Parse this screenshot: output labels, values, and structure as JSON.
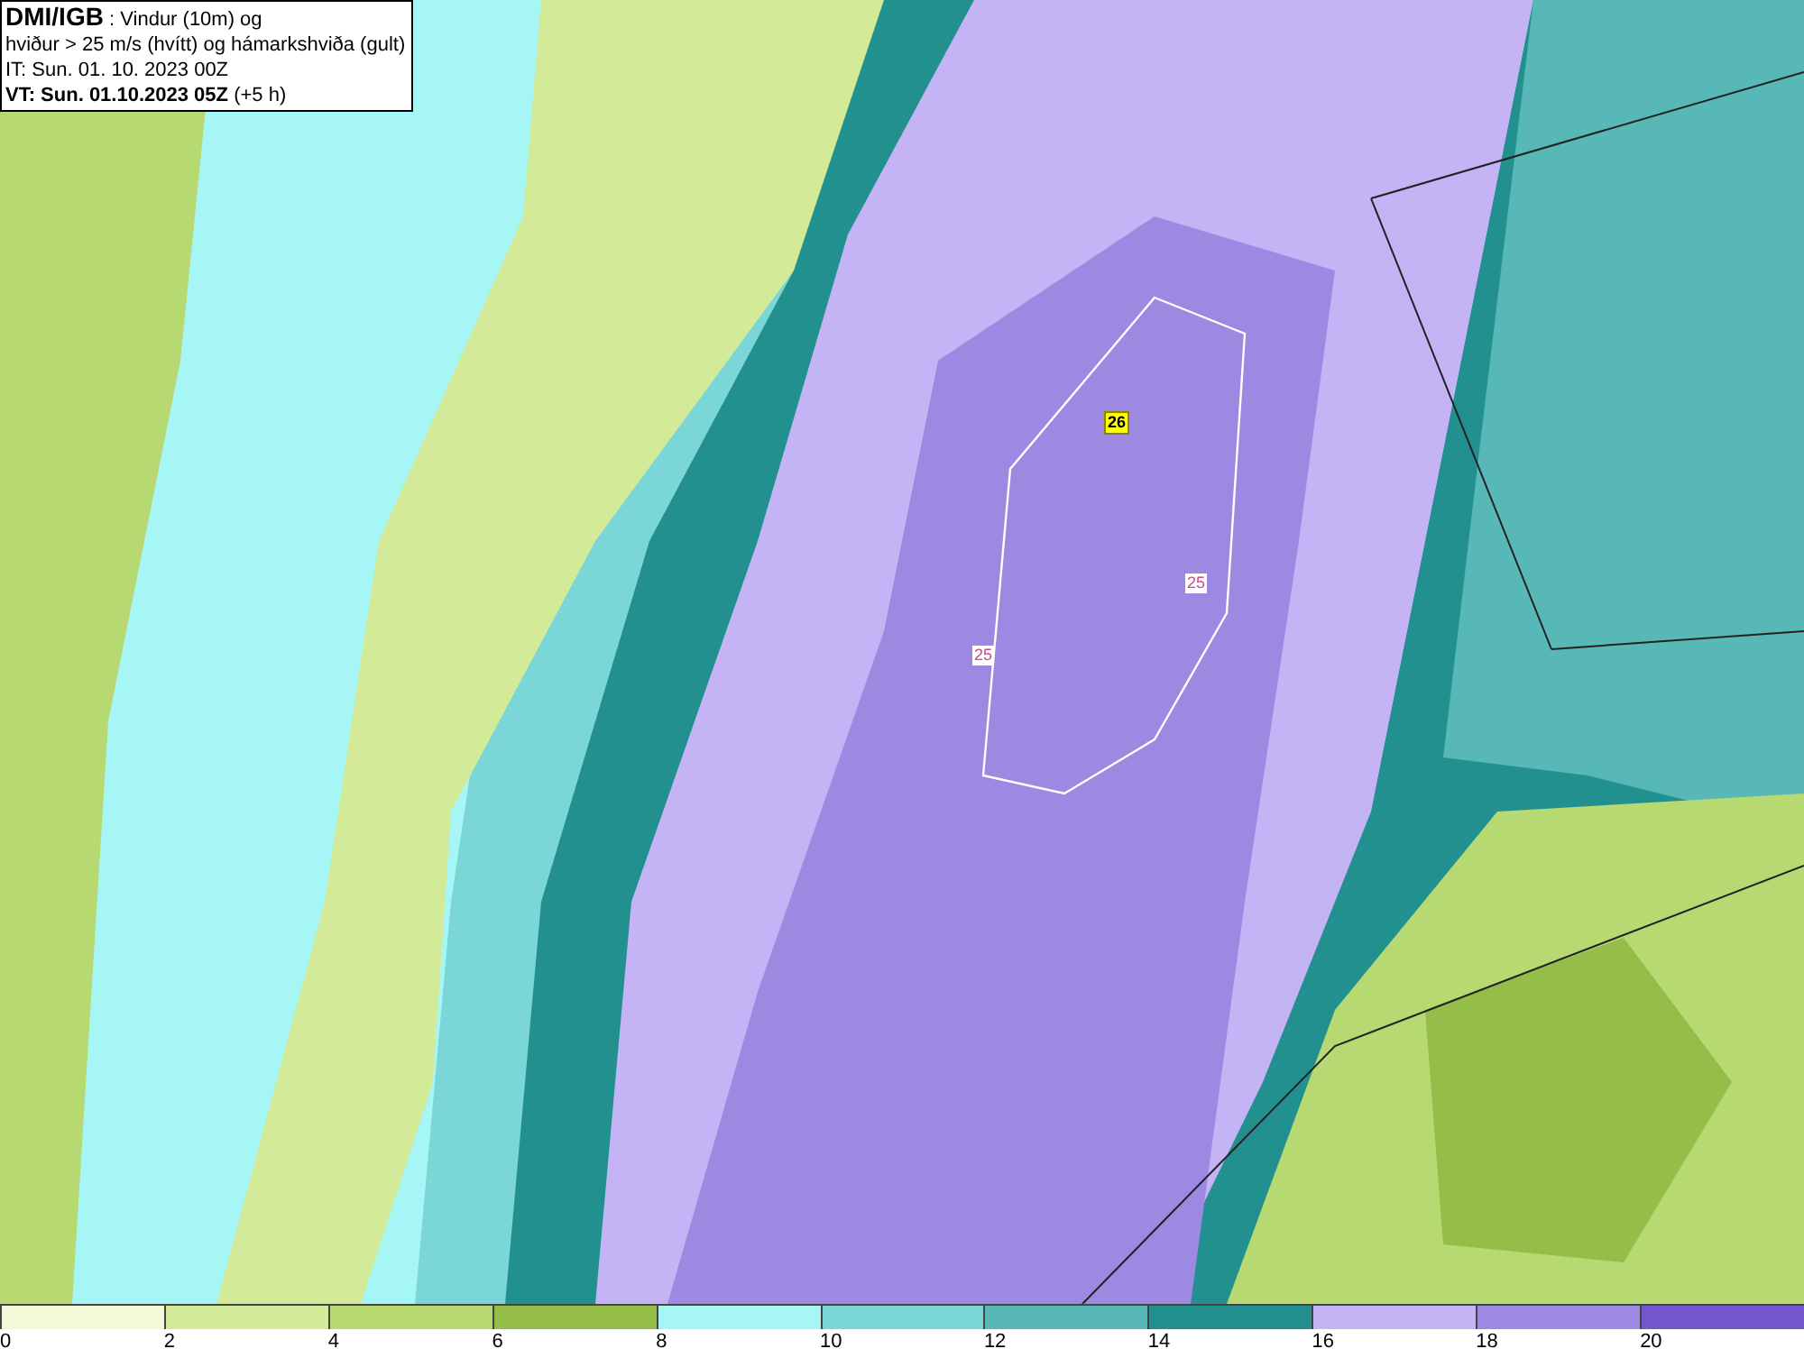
{
  "title_box": {
    "source": "DMI/IGB",
    "lines": [
      " : Vindur (10m) og",
      "hviður > 25 m/s (hvítt) og hámarkshviða (gult)",
      "IT: Sun. 01. 10. 2023 00Z"
    ],
    "valid_time": "VT: Sun. 01.10.2023 05Z",
    "lead": " (+5 h)"
  },
  "map_labels": [
    {
      "kind": "max",
      "text": "26"
    },
    {
      "kind": "contour",
      "text": "25"
    },
    {
      "kind": "contour",
      "text": "25"
    }
  ],
  "legend": [
    {
      "label": "0",
      "color": "#f4fad8"
    },
    {
      "label": "2",
      "color": "#d3eb98"
    },
    {
      "label": "4",
      "color": "#b6d972"
    },
    {
      "label": "6",
      "color": "#94be47"
    },
    {
      "label": "8",
      "color": "#a7f6f6"
    },
    {
      "label": "10",
      "color": "#7bd7d7"
    },
    {
      "label": "12",
      "color": "#58b7b7"
    },
    {
      "label": "14",
      "color": "#239090"
    },
    {
      "label": "16",
      "color": "#c4b4f6"
    },
    {
      "label": "18",
      "color": "#9d88e2"
    },
    {
      "label": "20",
      "color": "#7456cc"
    }
  ]
}
